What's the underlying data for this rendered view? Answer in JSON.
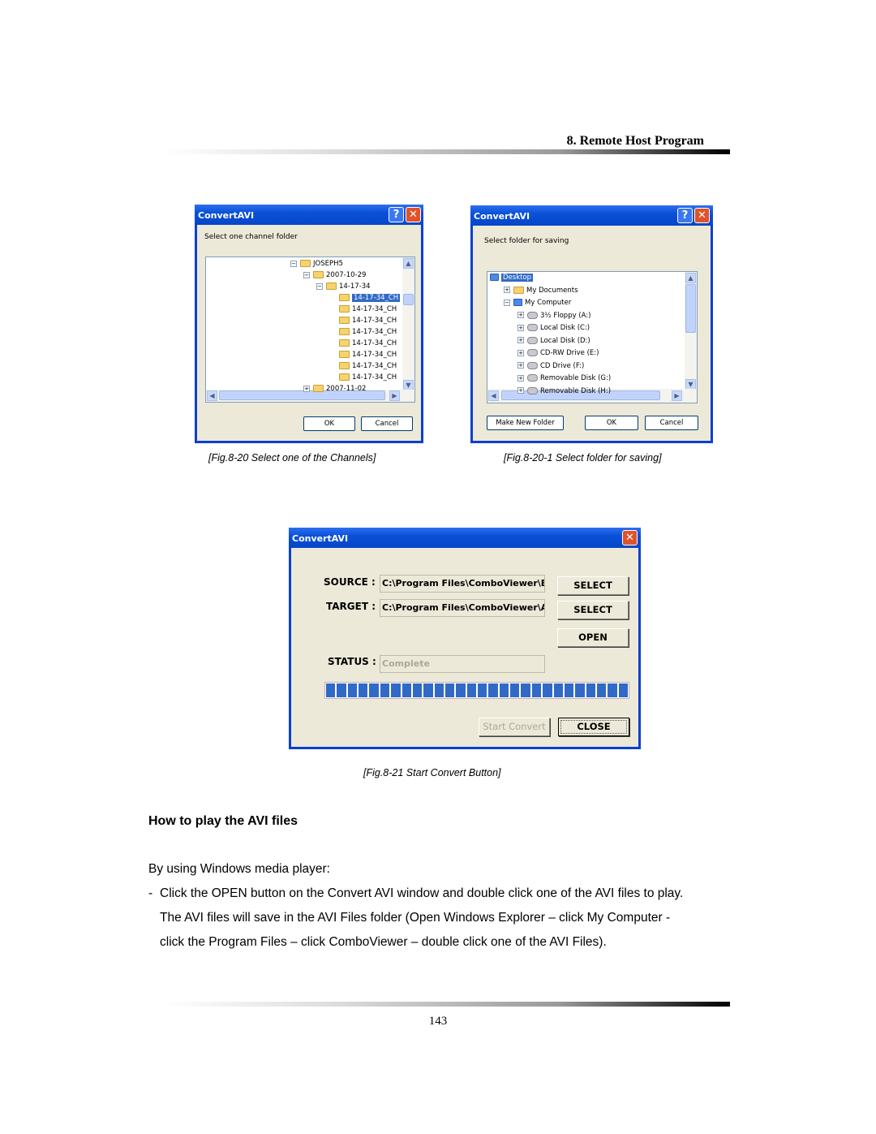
{
  "header": {
    "section_title": "8. Remote Host Program"
  },
  "fig1": {
    "title": "ConvertAVI",
    "prompt": "Select one channel folder",
    "tree": [
      {
        "label": "JOSEPH5",
        "level": 0,
        "expander": "-"
      },
      {
        "label": "2007-10-29",
        "level": 1,
        "expander": "-"
      },
      {
        "label": "14-17-34",
        "level": 2,
        "expander": "-"
      },
      {
        "label": "14-17-34_CH",
        "level": 3,
        "selected": true
      },
      {
        "label": "14-17-34_CH",
        "level": 3
      },
      {
        "label": "14-17-34_CH",
        "level": 3
      },
      {
        "label": "14-17-34_CH",
        "level": 3
      },
      {
        "label": "14-17-34_CH",
        "level": 3
      },
      {
        "label": "14-17-34_CH",
        "level": 3
      },
      {
        "label": "14-17-34_CH",
        "level": 3
      },
      {
        "label": "14-17-34_CH",
        "level": 3
      },
      {
        "label": "2007-11-02",
        "level": 1,
        "expander": "+"
      }
    ],
    "ok": "OK",
    "cancel": "Cancel",
    "caption": "[Fig.8-20 Select one of the Channels]"
  },
  "fig2": {
    "title": "ConvertAVI",
    "prompt": "Select folder for saving",
    "tree": [
      {
        "label": "Desktop",
        "level": 0,
        "selected": true,
        "icon": "desktop"
      },
      {
        "label": "My Documents",
        "level": 1,
        "expander": "+",
        "icon": "documents"
      },
      {
        "label": "My Computer",
        "level": 1,
        "expander": "-",
        "icon": "computer"
      },
      {
        "label": "3½ Floppy (A:)",
        "level": 2,
        "expander": "+",
        "icon": "floppy"
      },
      {
        "label": "Local Disk (C:)",
        "level": 2,
        "expander": "+",
        "icon": "disk"
      },
      {
        "label": "Local Disk (D:)",
        "level": 2,
        "expander": "+",
        "icon": "disk"
      },
      {
        "label": "CD-RW Drive (E:)",
        "level": 2,
        "expander": "+",
        "icon": "cd"
      },
      {
        "label": "CD Drive (F:)",
        "level": 2,
        "expander": "+",
        "icon": "cd"
      },
      {
        "label": "Removable Disk (G:)",
        "level": 2,
        "expander": "+",
        "icon": "disk"
      },
      {
        "label": "Removable Disk (H:)",
        "level": 2,
        "expander": "+",
        "icon": "disk"
      }
    ],
    "make_folder": "Make New Folder",
    "ok": "OK",
    "cancel": "Cancel",
    "caption": "[Fig.8-20-1 Select folder for saving]"
  },
  "fig3": {
    "title": "ConvertAVI",
    "source_label": "SOURCE :",
    "source_value": "C:\\Program Files\\ComboViewer\\Bac",
    "target_label": "TARGET :",
    "target_value": "C:\\Program Files\\ComboViewer\\AVI",
    "select1": "SELECT",
    "select2": "SELECT",
    "open": "OPEN",
    "status_label": "STATUS :",
    "status_value": "Complete",
    "progress": 1.0,
    "start": "Start Convert",
    "close": "CLOSE",
    "caption": "[Fig.8-21 Start Convert Button]"
  },
  "section": {
    "heading": "How to play the AVI files",
    "intro": "By using Windows media player:",
    "bullet_marker": "-",
    "lines": [
      "Click the OPEN button on the Convert AVI window and double click one of the AVI files to play.",
      "The AVI files will save in the AVI Files folder (Open Windows Explorer – click My Computer -",
      "click the Program Files – click ComboViewer – double click one of the AVI Files)."
    ]
  },
  "footer": {
    "page_number": "143"
  }
}
